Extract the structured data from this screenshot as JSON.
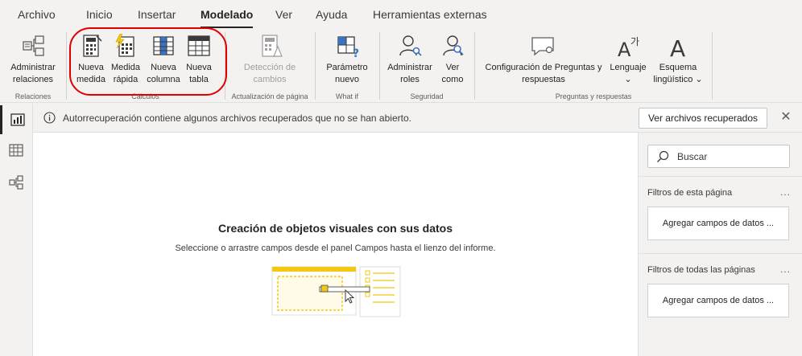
{
  "menu": {
    "tabs": [
      {
        "label": "Archivo"
      },
      {
        "label": "Inicio"
      },
      {
        "label": "Insertar"
      },
      {
        "label": "Modelado",
        "active": true
      },
      {
        "label": "Ver"
      },
      {
        "label": "Ayuda"
      },
      {
        "label": "Herramientas externas"
      }
    ]
  },
  "ribbon": {
    "relaciones": {
      "group_label": "Relaciones",
      "manage": {
        "line1": "Administrar",
        "line2": "relaciones",
        "icon": "manage-relationships-icon"
      }
    },
    "calculos": {
      "group_label": "Cálculos",
      "new_measure": {
        "line1": "Nueva",
        "line2": "medida",
        "icon": "calculator-icon"
      },
      "quick_measure": {
        "line1": "Medida",
        "line2": "rápida",
        "icon": "quick-measure-icon"
      },
      "new_column": {
        "line1": "Nueva",
        "line2": "columna",
        "icon": "table-column-icon"
      },
      "new_table": {
        "line1": "Nueva",
        "line2": "tabla",
        "icon": "table-icon"
      }
    },
    "actualizacion": {
      "group_label": "Actualización de página",
      "change_detection": {
        "line1": "Detección de",
        "line2": "cambios",
        "icon": "change-detection-icon",
        "disabled": true
      }
    },
    "whatif": {
      "group_label": "What if",
      "parameter": {
        "line1": "Parámetro",
        "line2": "nuevo",
        "icon": "parameter-icon"
      }
    },
    "seguridad": {
      "group_label": "Seguridad",
      "manage_roles": {
        "line1": "Administrar",
        "line2": "roles",
        "icon": "manage-roles-icon"
      },
      "view_as": {
        "line1": "Ver",
        "line2": "como",
        "icon": "view-as-icon"
      }
    },
    "preguntas": {
      "group_label": "Preguntas y respuestas",
      "qa_config": {
        "line1": "Configuración de Preguntas y",
        "line2": "respuestas",
        "icon": "qa-setup-icon"
      },
      "language": {
        "line1": "Lenguaje",
        "line2": "⌄",
        "icon": "language-icon"
      },
      "schema": {
        "line1": "Esquema",
        "line2": "lingüístico ⌄",
        "icon": "linguistic-schema-icon"
      }
    }
  },
  "rail": {
    "items": [
      {
        "icon": "report-view-icon",
        "active": true
      },
      {
        "icon": "data-view-icon"
      },
      {
        "icon": "model-view-icon"
      }
    ]
  },
  "notice": {
    "text": "Autorrecuperación contiene algunos archivos recuperados que no se han abierto.",
    "button": "Ver archivos recuperados",
    "close": "✕"
  },
  "canvas": {
    "title": "Creación de objetos visuales con sus datos",
    "subtitle": "Seleccione o arrastre campos desde el panel Campos hasta el lienzo del informe."
  },
  "filters": {
    "search_placeholder": "Buscar",
    "page_filters_title": "Filtros de esta página",
    "page_filters_well": "Agregar campos de datos ...",
    "all_pages_title": "Filtros de todas las páginas",
    "all_pages_well": "Agregar campos de datos ...",
    "more": "..."
  },
  "colors": {
    "highlight": "#e00000",
    "accent_yellow": "#f2c811",
    "icon_blue": "#3a73c2",
    "background": "#f3f2f1"
  }
}
